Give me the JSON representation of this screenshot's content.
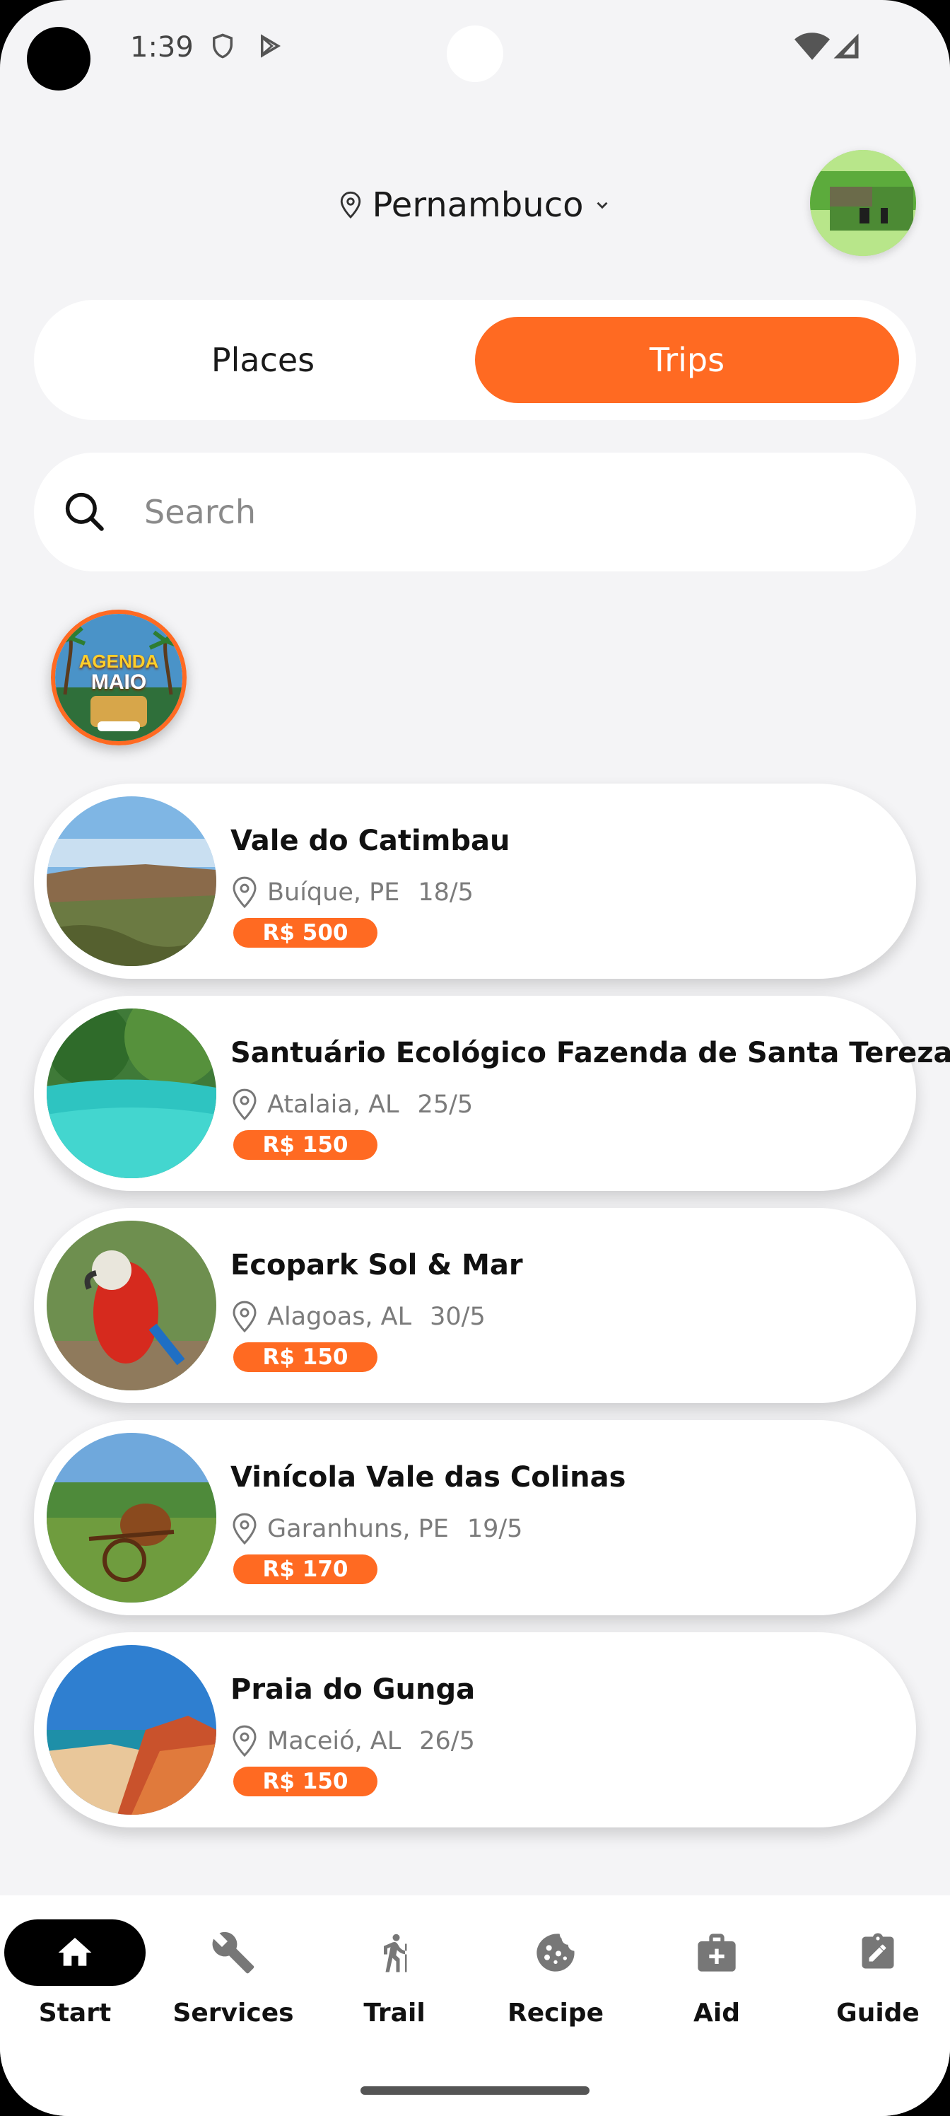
{
  "status_bar": {
    "time": "1:39"
  },
  "header": {
    "location": "Pernambuco"
  },
  "tabs": {
    "places": "Places",
    "trips": "Trips",
    "active": "trips"
  },
  "search": {
    "placeholder": "Search"
  },
  "story": {
    "label_line1": "AGENDA",
    "label_line2": "MAIO"
  },
  "trips": [
    {
      "title": "Vale do Catimbau",
      "location": "Buíque, PE",
      "date": "18/5",
      "price": "R$ 500"
    },
    {
      "title": "Santuário Ecológico Fazenda de Santa Tereza",
      "location": "Atalaia, AL",
      "date": "25/5",
      "price": "R$ 150"
    },
    {
      "title": "Ecopark Sol & Mar",
      "location": "Alagoas, AL",
      "date": "30/5",
      "price": "R$ 150"
    },
    {
      "title": "Vinícola Vale das Colinas",
      "location": "Garanhuns, PE",
      "date": "19/5",
      "price": "R$ 170"
    },
    {
      "title": "Praia do Gunga",
      "location": "Maceió, AL",
      "date": "26/5",
      "price": "R$ 150"
    }
  ],
  "nav": [
    {
      "label": "Start",
      "icon": "home-icon",
      "active": true
    },
    {
      "label": "Services",
      "icon": "wrench-icon",
      "active": false
    },
    {
      "label": "Trail",
      "icon": "hiker-icon",
      "active": false
    },
    {
      "label": "Recipe",
      "icon": "cookie-icon",
      "active": false
    },
    {
      "label": "Aid",
      "icon": "first-aid-icon",
      "active": false
    },
    {
      "label": "Guide",
      "icon": "edit-note-icon",
      "active": false
    }
  ],
  "colors": {
    "accent": "#ff6a22",
    "background": "#f4f4f6",
    "card": "#ffffff"
  }
}
